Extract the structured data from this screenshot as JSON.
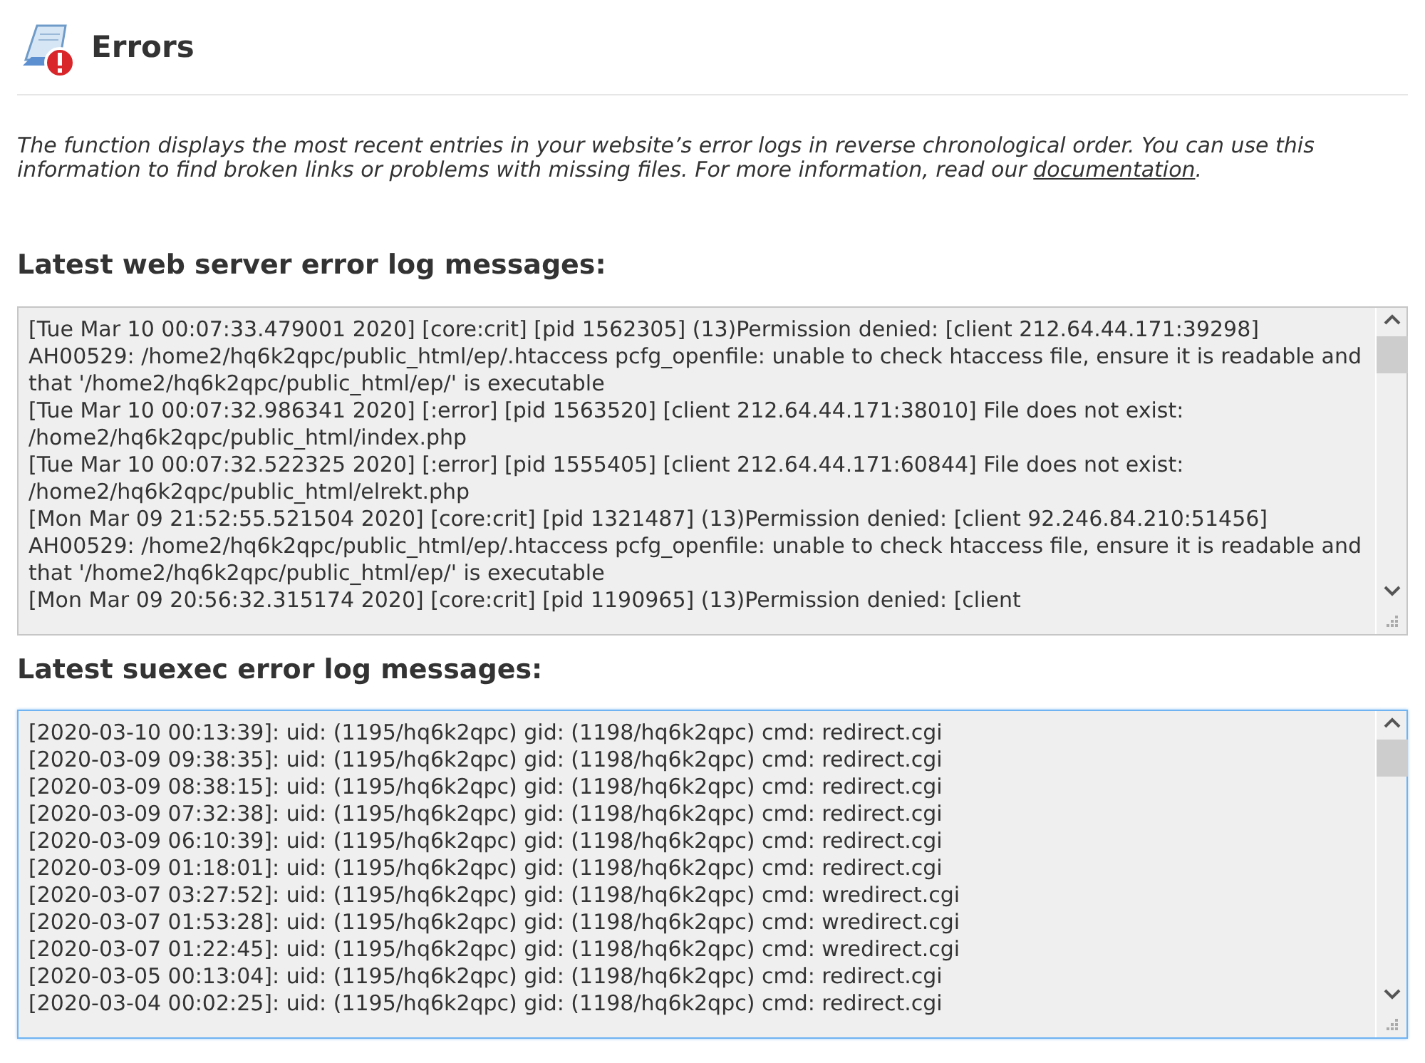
{
  "page": {
    "title": "Errors"
  },
  "intro": {
    "text": "The function displays the most recent entries in your website’s error logs in reverse chronological order. You can use this information to find broken links or problems with missing files. For more information, read our ",
    "link": "documentation",
    "end": "."
  },
  "logs": [
    {
      "heading": "Latest web server error log messages:",
      "focused": false,
      "entries": [
        "[Tue Mar 10 00:07:33.479001 2020] [core:crit] [pid 1562305] (13)Permission denied: [client 212.64.44.171:39298] AH00529: /home2/hq6k2qpc/public_html/ep/.htaccess pcfg_openfile: unable to check htaccess file, ensure it is readable and that '/home2/hq6k2qpc/public_html/ep/' is executable",
        "[Tue Mar 10 00:07:32.986341 2020] [:error] [pid 1563520] [client 212.64.44.171:38010] File does not exist: /home2/hq6k2qpc/public_html/index.php",
        "[Tue Mar 10 00:07:32.522325 2020] [:error] [pid 1555405] [client 212.64.44.171:60844] File does not exist: /home2/hq6k2qpc/public_html/elrekt.php",
        "[Mon Mar 09 21:52:55.521504 2020] [core:crit] [pid 1321487] (13)Permission denied: [client 92.246.84.210:51456] AH00529: /home2/hq6k2qpc/public_html/ep/.htaccess pcfg_openfile: unable to check htaccess file, ensure it is readable and that '/home2/hq6k2qpc/public_html/ep/' is executable",
        "[Mon Mar 09 20:56:32.315174 2020] [core:crit] [pid 1190965] (13)Permission denied: [client"
      ]
    },
    {
      "heading": "Latest suexec error log messages:",
      "focused": true,
      "entries": [
        "[2020-03-10 00:13:39]: uid: (1195/hq6k2qpc) gid: (1198/hq6k2qpc) cmd: redirect.cgi",
        "[2020-03-09 09:38:35]: uid: (1195/hq6k2qpc) gid: (1198/hq6k2qpc) cmd: redirect.cgi",
        "[2020-03-09 08:38:15]: uid: (1195/hq6k2qpc) gid: (1198/hq6k2qpc) cmd: redirect.cgi",
        "[2020-03-09 07:32:38]: uid: (1195/hq6k2qpc) gid: (1198/hq6k2qpc) cmd: redirect.cgi",
        "[2020-03-09 06:10:39]: uid: (1195/hq6k2qpc) gid: (1198/hq6k2qpc) cmd: redirect.cgi",
        "[2020-03-09 01:18:01]: uid: (1195/hq6k2qpc) gid: (1198/hq6k2qpc) cmd: redirect.cgi",
        "[2020-03-07 03:27:52]: uid: (1195/hq6k2qpc) gid: (1198/hq6k2qpc) cmd: wredirect.cgi",
        "[2020-03-07 01:53:28]: uid: (1195/hq6k2qpc) gid: (1198/hq6k2qpc) cmd: wredirect.cgi",
        "[2020-03-07 01:22:45]: uid: (1195/hq6k2qpc) gid: (1198/hq6k2qpc) cmd: wredirect.cgi",
        "[2020-03-05 00:13:04]: uid: (1195/hq6k2qpc) gid: (1198/hq6k2qpc) cmd: redirect.cgi",
        "[2020-03-04 00:02:25]: uid: (1195/hq6k2qpc) gid: (1198/hq6k2qpc) cmd: redirect.cgi"
      ]
    }
  ]
}
